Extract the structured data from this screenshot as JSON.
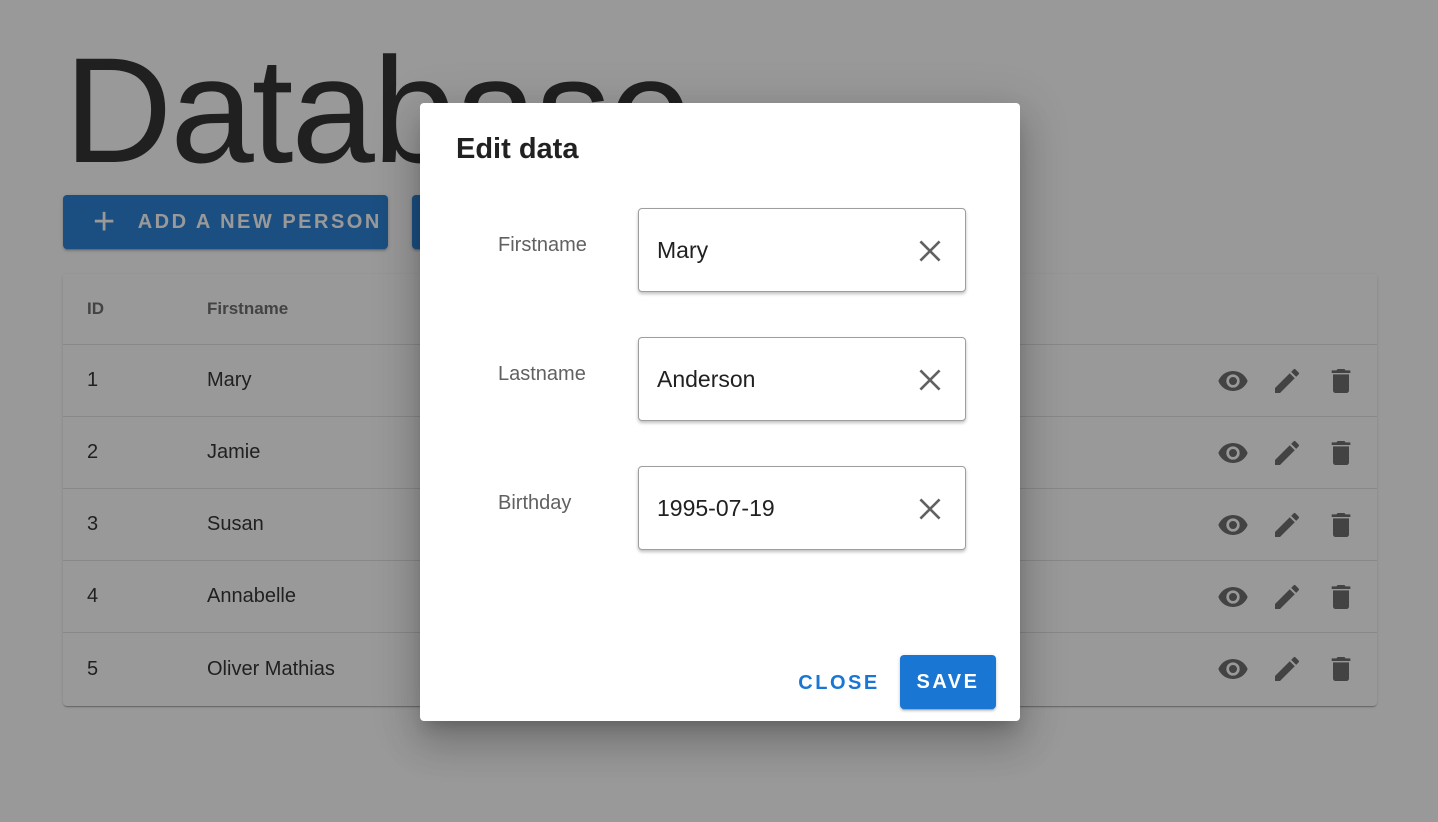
{
  "page": {
    "title": "Database",
    "add_button_label": "ADD A NEW PERSON",
    "add_button_icon": "plus-icon"
  },
  "table": {
    "headers": {
      "id": "ID",
      "firstname": "Firstname"
    },
    "rows": [
      {
        "id": "1",
        "firstname": "Mary"
      },
      {
        "id": "2",
        "firstname": "Jamie"
      },
      {
        "id": "3",
        "firstname": "Susan"
      },
      {
        "id": "4",
        "firstname": "Annabelle"
      },
      {
        "id": "5",
        "firstname": "Oliver Mathias"
      }
    ],
    "row_action_icons": [
      "eye-icon",
      "pencil-icon",
      "trash-icon"
    ]
  },
  "dialog": {
    "title": "Edit data",
    "fields": [
      {
        "label": "Firstname",
        "value": "Mary"
      },
      {
        "label": "Lastname",
        "value": "Anderson"
      },
      {
        "label": "Birthday",
        "value": "1995-07-19"
      }
    ],
    "clear_icon": "close-icon",
    "close_label": "CLOSE",
    "save_label": "SAVE"
  },
  "colors": {
    "primary": "#1976d2",
    "scrim": "rgba(33,33,33,0.46)",
    "icon": "#616161"
  }
}
